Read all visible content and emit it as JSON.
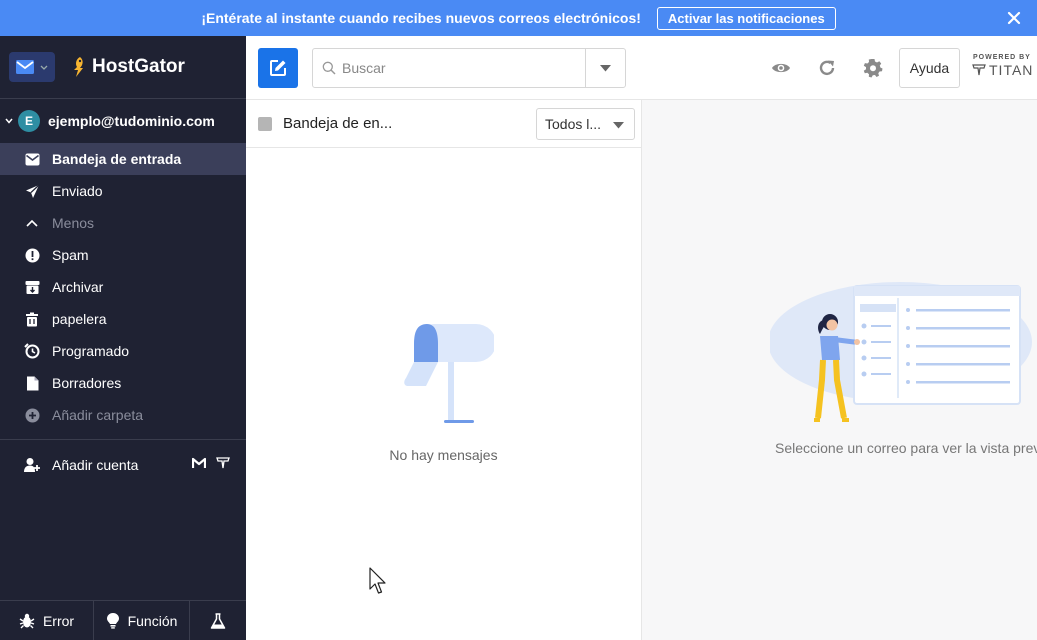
{
  "banner": {
    "text": "¡Entérate al instante cuando recibes nuevos correos electrónicos!",
    "button": "Activar las notificaciones"
  },
  "sidebar": {
    "brand": "HostGator",
    "account_initial": "E",
    "account_email": "ejemplo@tudominio.com",
    "folders": [
      {
        "label": "Bandeja de entrada",
        "icon": "inbox-icon",
        "active": true
      },
      {
        "label": "Enviado",
        "icon": "send-icon"
      },
      {
        "label": "Menos",
        "icon": "chevron-up-icon"
      },
      {
        "label": "Spam",
        "icon": "spam-icon"
      },
      {
        "label": "Archivar",
        "icon": "archive-icon"
      },
      {
        "label": "papelera",
        "icon": "trash-icon"
      },
      {
        "label": "Programado",
        "icon": "scheduled-icon"
      },
      {
        "label": "Borradores",
        "icon": "drafts-icon"
      },
      {
        "label": "Añadir carpeta",
        "icon": "add-folder-icon"
      }
    ],
    "add_account": "Añadir cuenta",
    "footer": {
      "bug": "Error",
      "feature": "Función"
    }
  },
  "toolbar": {
    "search_placeholder": "Buscar",
    "help": "Ayuda",
    "powered_by": "POWERED BY",
    "titan": "TITAN"
  },
  "list": {
    "title": "Bandeja de en...",
    "filter": "Todos l...",
    "empty": "No hay mensajes"
  },
  "preview": {
    "hint": "Seleccione un correo para ver la vista previa"
  },
  "colors": {
    "banner": "#4a8af4",
    "sidebar": "#1f2233",
    "accent": "#1a73e8"
  }
}
